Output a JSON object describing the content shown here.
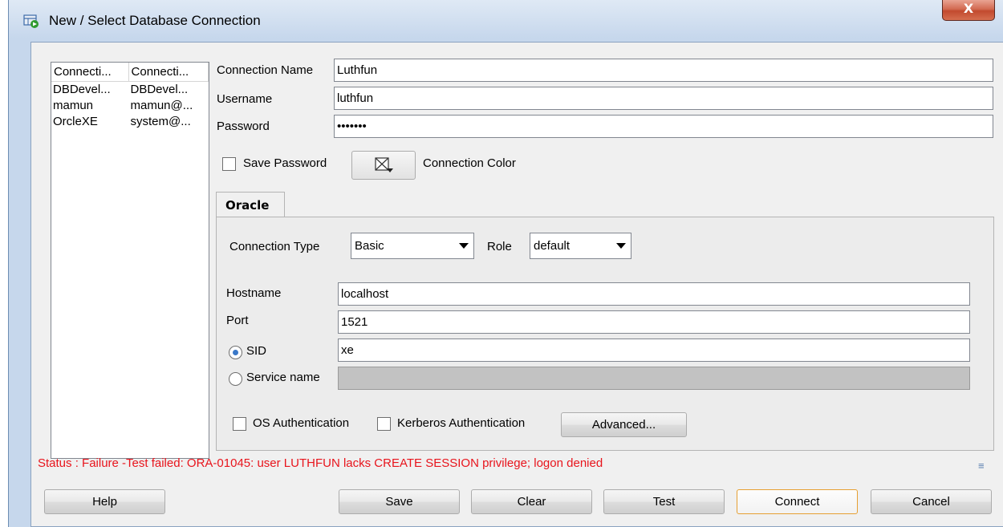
{
  "window": {
    "title": "New / Select Database Connection",
    "close_label": "X"
  },
  "connections": {
    "headers": [
      "Connecti...",
      "Connecti..."
    ],
    "rows": [
      [
        "DBDevel...",
        "DBDevel..."
      ],
      [
        "mamun",
        "mamun@..."
      ],
      [
        "OrcleXE",
        "system@..."
      ]
    ]
  },
  "form": {
    "connection_name_label": "Connection Name",
    "connection_name_value": "Luthfun",
    "username_label": "Username",
    "username_value": "luthfun",
    "password_label": "Password",
    "password_value": "•••••••",
    "save_password_label": "Save Password",
    "connection_color_label": "Connection Color"
  },
  "tab": {
    "label": "Oracle"
  },
  "oracle": {
    "connection_type_label": "Connection Type",
    "connection_type_value": "Basic",
    "role_label": "Role",
    "role_value": "default",
    "hostname_label": "Hostname",
    "hostname_value": "localhost",
    "port_label": "Port",
    "port_value": "1521",
    "sid_label": "SID",
    "sid_value": "xe",
    "service_name_label": "Service name",
    "service_name_value": "",
    "os_auth_label": "OS Authentication",
    "kerberos_auth_label": "Kerberos Authentication",
    "advanced_label": "Advanced..."
  },
  "status": {
    "text": "Status : Failure -Test failed: ORA-01045: user LUTHFUN lacks CREATE SESSION privilege; logon denied",
    "color": "#e8141c"
  },
  "buttons": {
    "help": "Help",
    "save": "Save",
    "clear": "Clear",
    "test": "Test",
    "connect": "Connect",
    "cancel": "Cancel"
  }
}
